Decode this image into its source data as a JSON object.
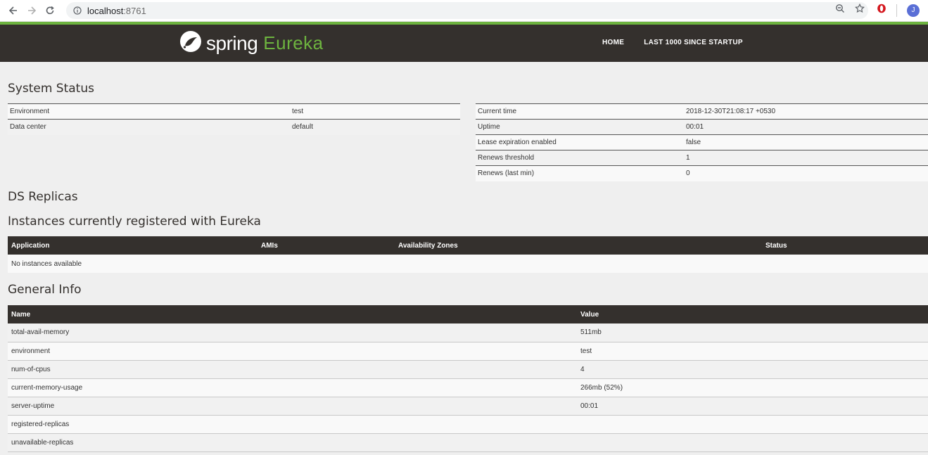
{
  "browser": {
    "url_host": "localhost",
    "url_port": ":8761",
    "avatar_initial": "J"
  },
  "navbar": {
    "brand_spring": "spring",
    "brand_eureka": "Eureka",
    "links": [
      "HOME",
      "LAST 1000 SINCE STARTUP"
    ]
  },
  "system_status": {
    "title": "System Status",
    "left": [
      {
        "k": "Environment",
        "v": "test"
      },
      {
        "k": "Data center",
        "v": "default"
      }
    ],
    "right": [
      {
        "k": "Current time",
        "v": "2018-12-30T21:08:17 +0530"
      },
      {
        "k": "Uptime",
        "v": "00:01"
      },
      {
        "k": "Lease expiration enabled",
        "v": "false"
      },
      {
        "k": "Renews threshold",
        "v": "1"
      },
      {
        "k": "Renews (last min)",
        "v": "0"
      }
    ]
  },
  "ds_replicas": {
    "title": "DS Replicas"
  },
  "instances": {
    "title": "Instances currently registered with Eureka",
    "headers": [
      "Application",
      "AMIs",
      "Availability Zones",
      "Status"
    ],
    "empty_text": "No instances available"
  },
  "general_info": {
    "title": "General Info",
    "headers": [
      "Name",
      "Value"
    ],
    "rows": [
      {
        "k": "total-avail-memory",
        "v": "511mb"
      },
      {
        "k": "environment",
        "v": "test"
      },
      {
        "k": "num-of-cpus",
        "v": "4"
      },
      {
        "k": "current-memory-usage",
        "v": "266mb (52%)"
      },
      {
        "k": "server-uptime",
        "v": "00:01"
      },
      {
        "k": "registered-replicas",
        "v": ""
      },
      {
        "k": "unavailable-replicas",
        "v": ""
      }
    ]
  },
  "colors": {
    "navbar_bg": "#34302d",
    "spring_green": "#6db33f"
  }
}
